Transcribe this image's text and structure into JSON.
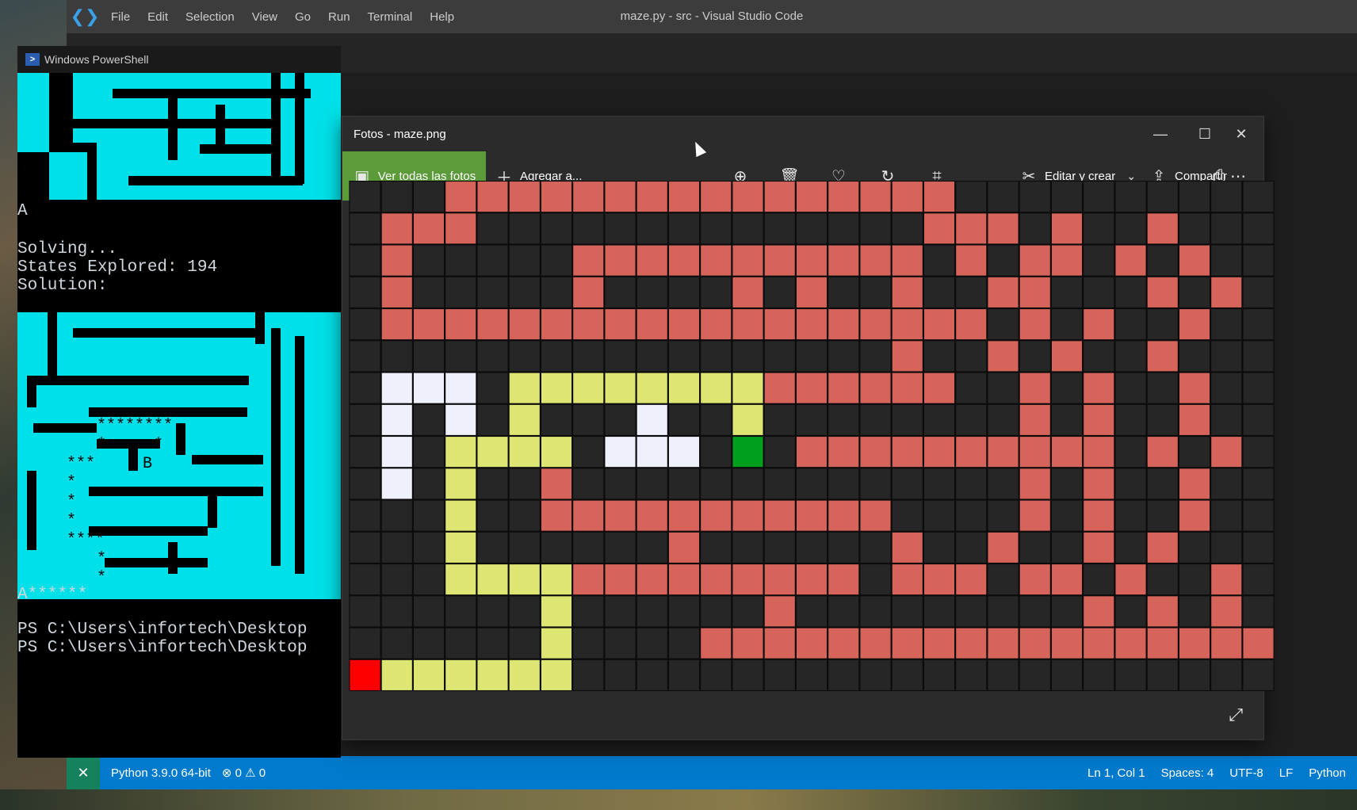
{
  "vscode": {
    "title": "maze.py - src - Visual Studio Code",
    "menu": [
      "File",
      "Edit",
      "Selection",
      "View",
      "Go",
      "Run",
      "Terminal",
      "Help"
    ],
    "status": {
      "python": "Python 3.9.0 64-bit",
      "problems": "⊗ 0 ⚠ 0",
      "position": "Ln 1, Col 1",
      "spaces": "Spaces: 4",
      "encoding": "UTF-8",
      "eol": "LF",
      "language": "Python"
    }
  },
  "powershell": {
    "title": "Windows PowerShell",
    "lines": {
      "a_label": "A",
      "solving": "Solving...",
      "states": "States Explored: 194",
      "solution": "Solution:",
      "a_stars": "A******",
      "prompt1": "PS C:\\Users\\infortech\\Desktop",
      "prompt2": "PS C:\\Users\\infortech\\Desktop"
    }
  },
  "photos": {
    "title": "Fotos - maze.png",
    "view_all": "Ver todas las fotos",
    "add_to": "Agregar a...",
    "edit_create": "Editar y crear",
    "share": "Compartir",
    "colors": {
      "wall": "#d7645a",
      "empty": "#262626",
      "path": "#dde672",
      "explored": "#eef0fa",
      "start": "#ff0000",
      "goal": "#00a01c",
      "gridline": "#0b0b0b"
    },
    "maze_rows": [
      "...################.........",
      ".###..............###.#..#.",
      ".#.....###########.#.##.#.#.",
      ".#.....#....#.#..#..##...#.#",
      ".###################.#.#..#.",
      ".................#..#.#..#..",
      ".EEE.PPPPPPPP######..#.#..#.",
      ".E.E.P...E..P........#.#..#.",
      ".E.PPPP.EEE.G.##########.#.#",
      ".E.P..#..............#.#..#.",
      "...P..###########....#.#..#.",
      "...P......#......#..#..#.#..",
      "...PPPP#########.###.##.#..#",
      "......P......#.........#.#.#",
      "......P....###################",
      "SPPPPPP....................."
    ]
  }
}
